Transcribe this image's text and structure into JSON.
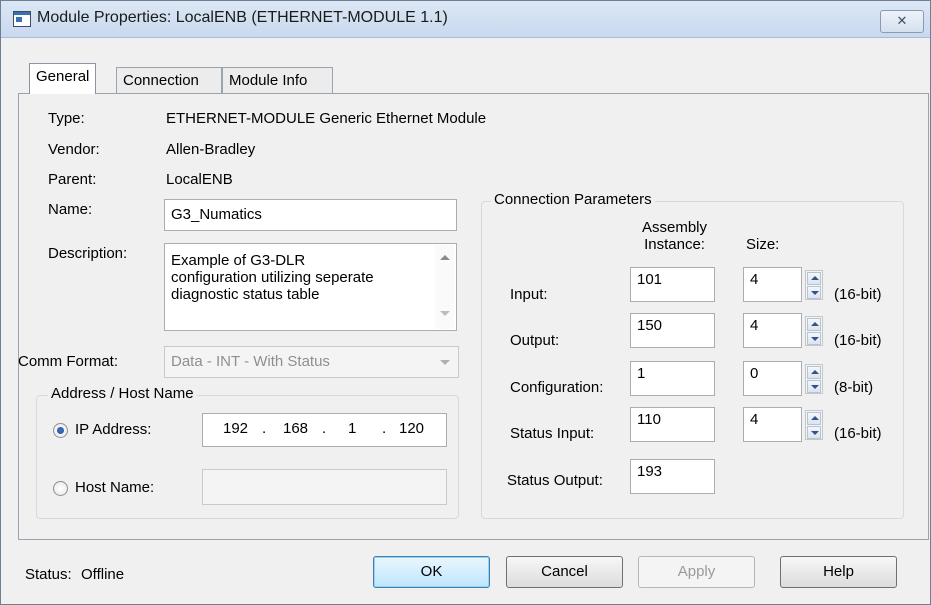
{
  "window": {
    "title": "Module Properties: LocalENB (ETHERNET-MODULE 1.1)",
    "close_glyph": "✕"
  },
  "tabs": [
    {
      "label": "General",
      "selected": true
    },
    {
      "label": "Connection",
      "selected": false
    },
    {
      "label": "Module Info",
      "selected": false
    }
  ],
  "general": {
    "type_label": "Type:",
    "type_value": "ETHERNET-MODULE Generic Ethernet Module",
    "vendor_label": "Vendor:",
    "vendor_value": "Allen-Bradley",
    "parent_label": "Parent:",
    "parent_value": "LocalENB",
    "name_label": "Name:",
    "name_value": "G3_Numatics",
    "description_label": "Description:",
    "description_value": "Example of G3-DLR\nconfiguration utilizing seperate\ndiagnostic status table",
    "comm_format_label": "Comm Format:",
    "comm_format_value": "Data - INT - With Status"
  },
  "address": {
    "group_title": "Address / Host Name",
    "ip_label": "IP Address:",
    "ip_selected": true,
    "ip_octets": [
      "192",
      "168",
      "1",
      "120"
    ],
    "ip_separator": ".",
    "host_label": "Host Name:",
    "host_selected": false,
    "host_value": ""
  },
  "connection_params": {
    "group_title": "Connection Parameters",
    "col_assembly": "Assembly\nInstance:",
    "col_size": "Size:",
    "rows": [
      {
        "label": "Input:",
        "instance": "101",
        "size": "4",
        "unit": "(16-bit)"
      },
      {
        "label": "Output:",
        "instance": "150",
        "size": "4",
        "unit": "(16-bit)"
      },
      {
        "label": "Configuration:",
        "instance": "1",
        "size": "0",
        "unit": "(8-bit)"
      },
      {
        "label": "Status Input:",
        "instance": "110",
        "size": "4",
        "unit": "(16-bit)"
      },
      {
        "label": "Status Output:",
        "instance": "193"
      }
    ]
  },
  "footer": {
    "status_label": "Status:",
    "status_value": "Offline",
    "ok": "OK",
    "cancel": "Cancel",
    "apply": "Apply",
    "help": "Help"
  },
  "colors": {
    "titlebar": "#c9d9ee",
    "ok_accent": "#3c7fb1",
    "dialog_bg": "#f0f0f0"
  }
}
